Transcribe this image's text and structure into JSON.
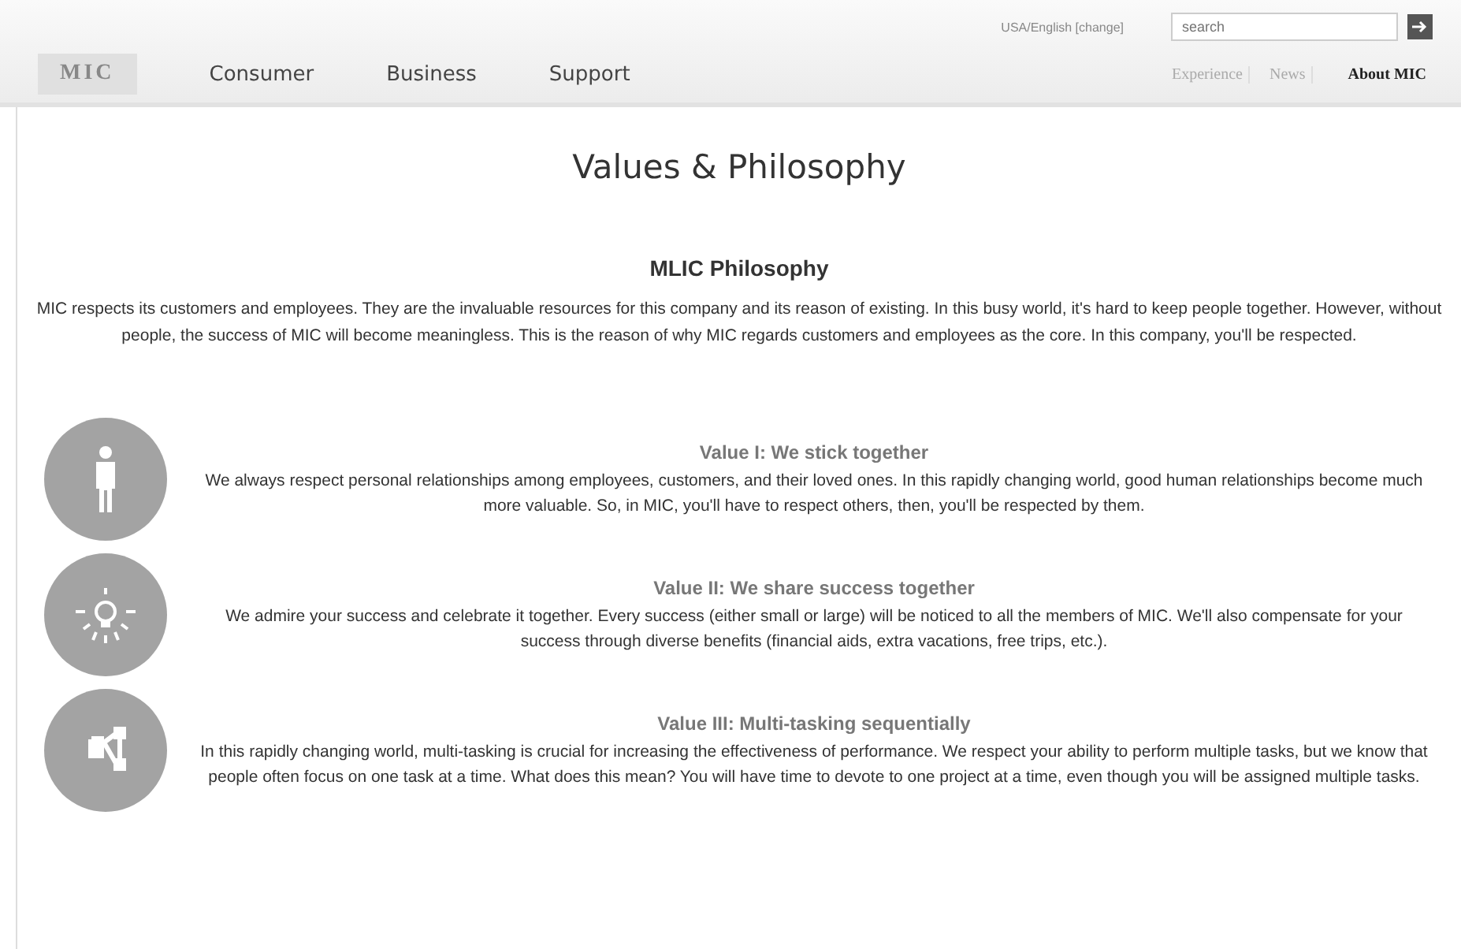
{
  "header": {
    "locale": "USA/English [change]",
    "search": {
      "placeholder": "search"
    },
    "logo": "MIC",
    "nav": [
      {
        "label": "Consumer"
      },
      {
        "label": "Business"
      },
      {
        "label": "Support"
      }
    ],
    "subnav": [
      {
        "label": "Experience",
        "selected": false
      },
      {
        "label": "News",
        "selected": false
      },
      {
        "label": "About MIC",
        "selected": true
      }
    ]
  },
  "title": "Values & Philosophy",
  "philosophy": {
    "heading": "MLIC Philosophy",
    "text": "MIC respects its customers and employees. They are the invaluable resources for this company and its reason of existing. In this busy world, it's hard to keep people together. However, without people, the success of MIC will become meaningless. This is the reason of why MIC regards customers and employees as the core. In this company, you'll be respected."
  },
  "values": [
    {
      "kind": "person",
      "heading": "Value I: We stick together",
      "text": "We always respect personal relationships among employees, customers, and their loved ones. In this rapidly changing world, good human relationships become much more valuable. So, in MIC, you'll have to respect others, then, you'll be respected by them."
    },
    {
      "kind": "bulb",
      "heading": "Value II: We share success together",
      "text": "We admire your success and celebrate it together. Every success (either small or large) will be noticed to all the members of MIC. We'll also compensate for your success through diverse benefits (financial aids, extra vacations, free trips, etc.)."
    },
    {
      "kind": "network",
      "heading": "Value III: Multi-tasking sequentially",
      "text": "In this rapidly changing world, multi-tasking is crucial for increasing the effectiveness of performance. We respect your ability to perform multiple tasks, but we know that people often focus on one task at a time. What does this mean? You will have time to devote to one project at a time, even though you will be assigned multiple tasks."
    }
  ]
}
